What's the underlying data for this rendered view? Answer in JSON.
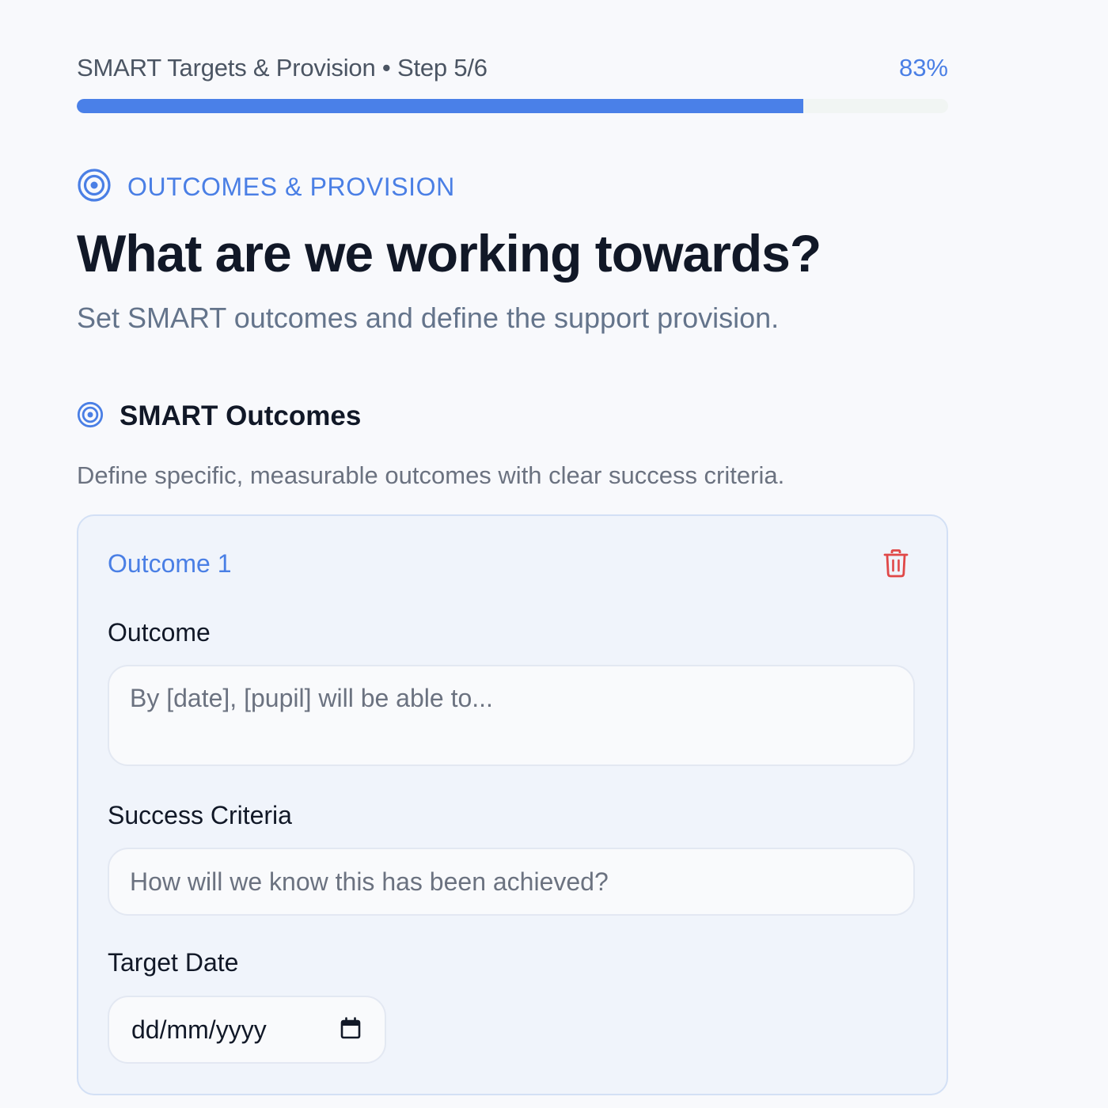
{
  "progress": {
    "step_label": "SMART Targets & Provision • Step 5/6",
    "percent_label": "83%",
    "fraction": 0.834
  },
  "header": {
    "eyebrow": "OUTCOMES & PROVISION",
    "title": "What are we working towards?",
    "subtitle": "Set SMART outcomes and define the support provision."
  },
  "section": {
    "title": "SMART Outcomes",
    "description": "Define specific, measurable outcomes with clear success criteria."
  },
  "outcome_card": {
    "title": "Outcome 1",
    "outcome_label": "Outcome",
    "outcome_placeholder": "By [date], [pupil] will be able to...",
    "criteria_label": "Success Criteria",
    "criteria_placeholder": "How will we know this has been achieved?",
    "date_label": "Target Date",
    "date_placeholder": "dd/mm/yyyy"
  },
  "colors": {
    "accent": "#4a7fe5",
    "delete": "#e04848",
    "card_bg": "#f0f4fb",
    "card_border": "#d3e0f5"
  },
  "icons": {
    "eyebrow": "target-icon",
    "section": "target-icon",
    "delete": "trash-icon",
    "date": "calendar-icon"
  }
}
